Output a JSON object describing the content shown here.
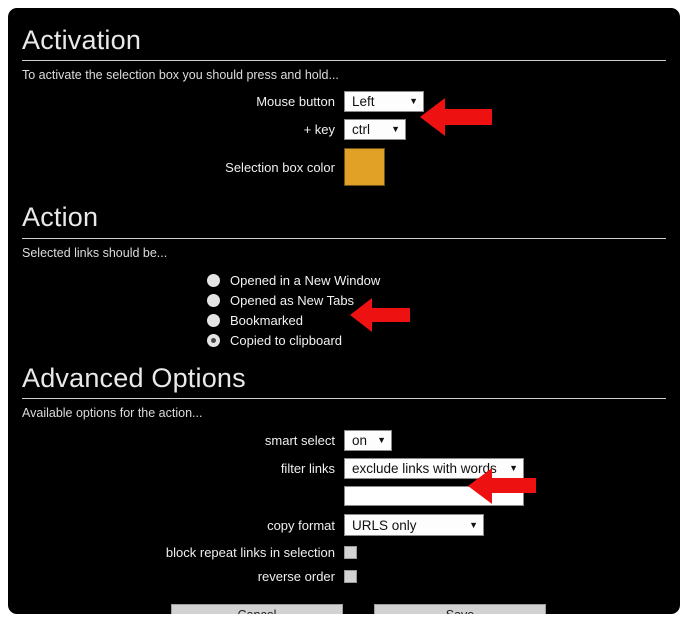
{
  "sections": {
    "activation": {
      "title": "Activation",
      "subtitle": "To activate the selection box you should press and hold...",
      "fields": {
        "mouse_button": {
          "label": "Mouse button",
          "value": "Left"
        },
        "modifier_key": {
          "label": "+ key",
          "value": "ctrl"
        },
        "selection_box_color": {
          "label": "Selection box color",
          "value": "#e0a126"
        }
      }
    },
    "action": {
      "title": "Action",
      "subtitle": "Selected links should be...",
      "options": [
        {
          "label": "Opened in a New Window",
          "selected": false
        },
        {
          "label": "Opened as New Tabs",
          "selected": false
        },
        {
          "label": "Bookmarked",
          "selected": false
        },
        {
          "label": "Copied to clipboard",
          "selected": true
        }
      ]
    },
    "advanced": {
      "title": "Advanced Options",
      "subtitle": "Available options for the action...",
      "fields": {
        "smart_select": {
          "label": "smart select",
          "value": "on"
        },
        "filter_links": {
          "label": "filter links",
          "value": "exclude links with words"
        },
        "filter_words": {
          "value": "",
          "placeholder": ""
        },
        "copy_format": {
          "label": "copy format",
          "value": "URLS only"
        },
        "block_repeat": {
          "label": "block repeat links in selection",
          "checked": false
        },
        "reverse_order": {
          "label": "reverse order",
          "checked": false
        }
      }
    }
  },
  "footer": {
    "cancel_label": "Cancel",
    "save_label": "Save"
  },
  "annotations": {
    "arrow_color": "#ee1111",
    "arrows": [
      {
        "name": "arrow-modifier-key"
      },
      {
        "name": "arrow-copied-to-clipboard"
      },
      {
        "name": "arrow-copy-format"
      }
    ]
  }
}
